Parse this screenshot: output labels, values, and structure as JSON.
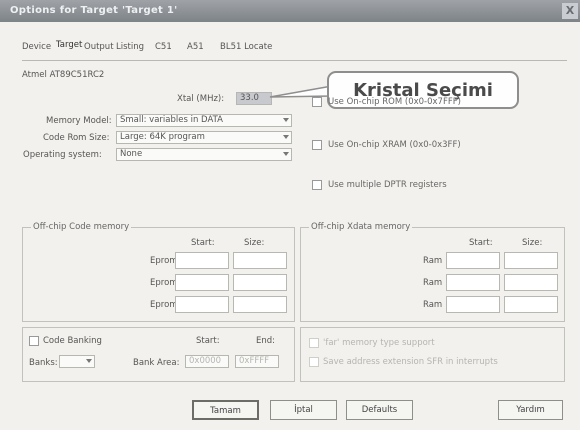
{
  "window": {
    "title": "Options for Target 'Target 1'",
    "close_label": "X"
  },
  "tabs": [
    "Device",
    "Target",
    "Output",
    "Listing",
    "C51",
    "A51",
    "BL51 Locate"
  ],
  "device_name": "Atmel AT89C51RC2",
  "xtal": {
    "label": "Xtal (MHz):",
    "value": "33.0"
  },
  "callout": {
    "text": "Kristal Seçimi"
  },
  "memory_model": {
    "label": "Memory Model:",
    "value": "Small: variables in DATA"
  },
  "code_rom": {
    "label": "Code Rom Size:",
    "value": "Large: 64K program"
  },
  "os": {
    "label": "Operating system:",
    "value": "None"
  },
  "checks": {
    "onchip_rom": "Use On-chip ROM (0x0-0x7FFF)",
    "onchip_xram": "Use On-chip XRAM (0x0-0x3FF)",
    "multi_dptr": "Use multiple DPTR registers"
  },
  "code_mem": {
    "title": "Off-chip Code memory",
    "start": "Start:",
    "size": "Size:",
    "rows": [
      "Eprom",
      "Eprom",
      "Eprom"
    ]
  },
  "xdata_mem": {
    "title": "Off-chip Xdata memory",
    "start": "Start:",
    "size": "Size:",
    "rows": [
      "Ram",
      "Ram",
      "Ram"
    ]
  },
  "banking": {
    "label": "Code Banking",
    "start": "Start:",
    "end": "End:",
    "banks_label": "Banks:",
    "bank_area_label": "Bank Area:",
    "bank_start": "0x0000",
    "bank_end": "0xFFFF"
  },
  "far": {
    "line1": "'far' memory type support",
    "line2": "Save address extension SFR in interrupts"
  },
  "buttons": {
    "ok": "Tamam",
    "cancel": "İptal",
    "defaults": "Defaults",
    "help": "Yardım"
  }
}
